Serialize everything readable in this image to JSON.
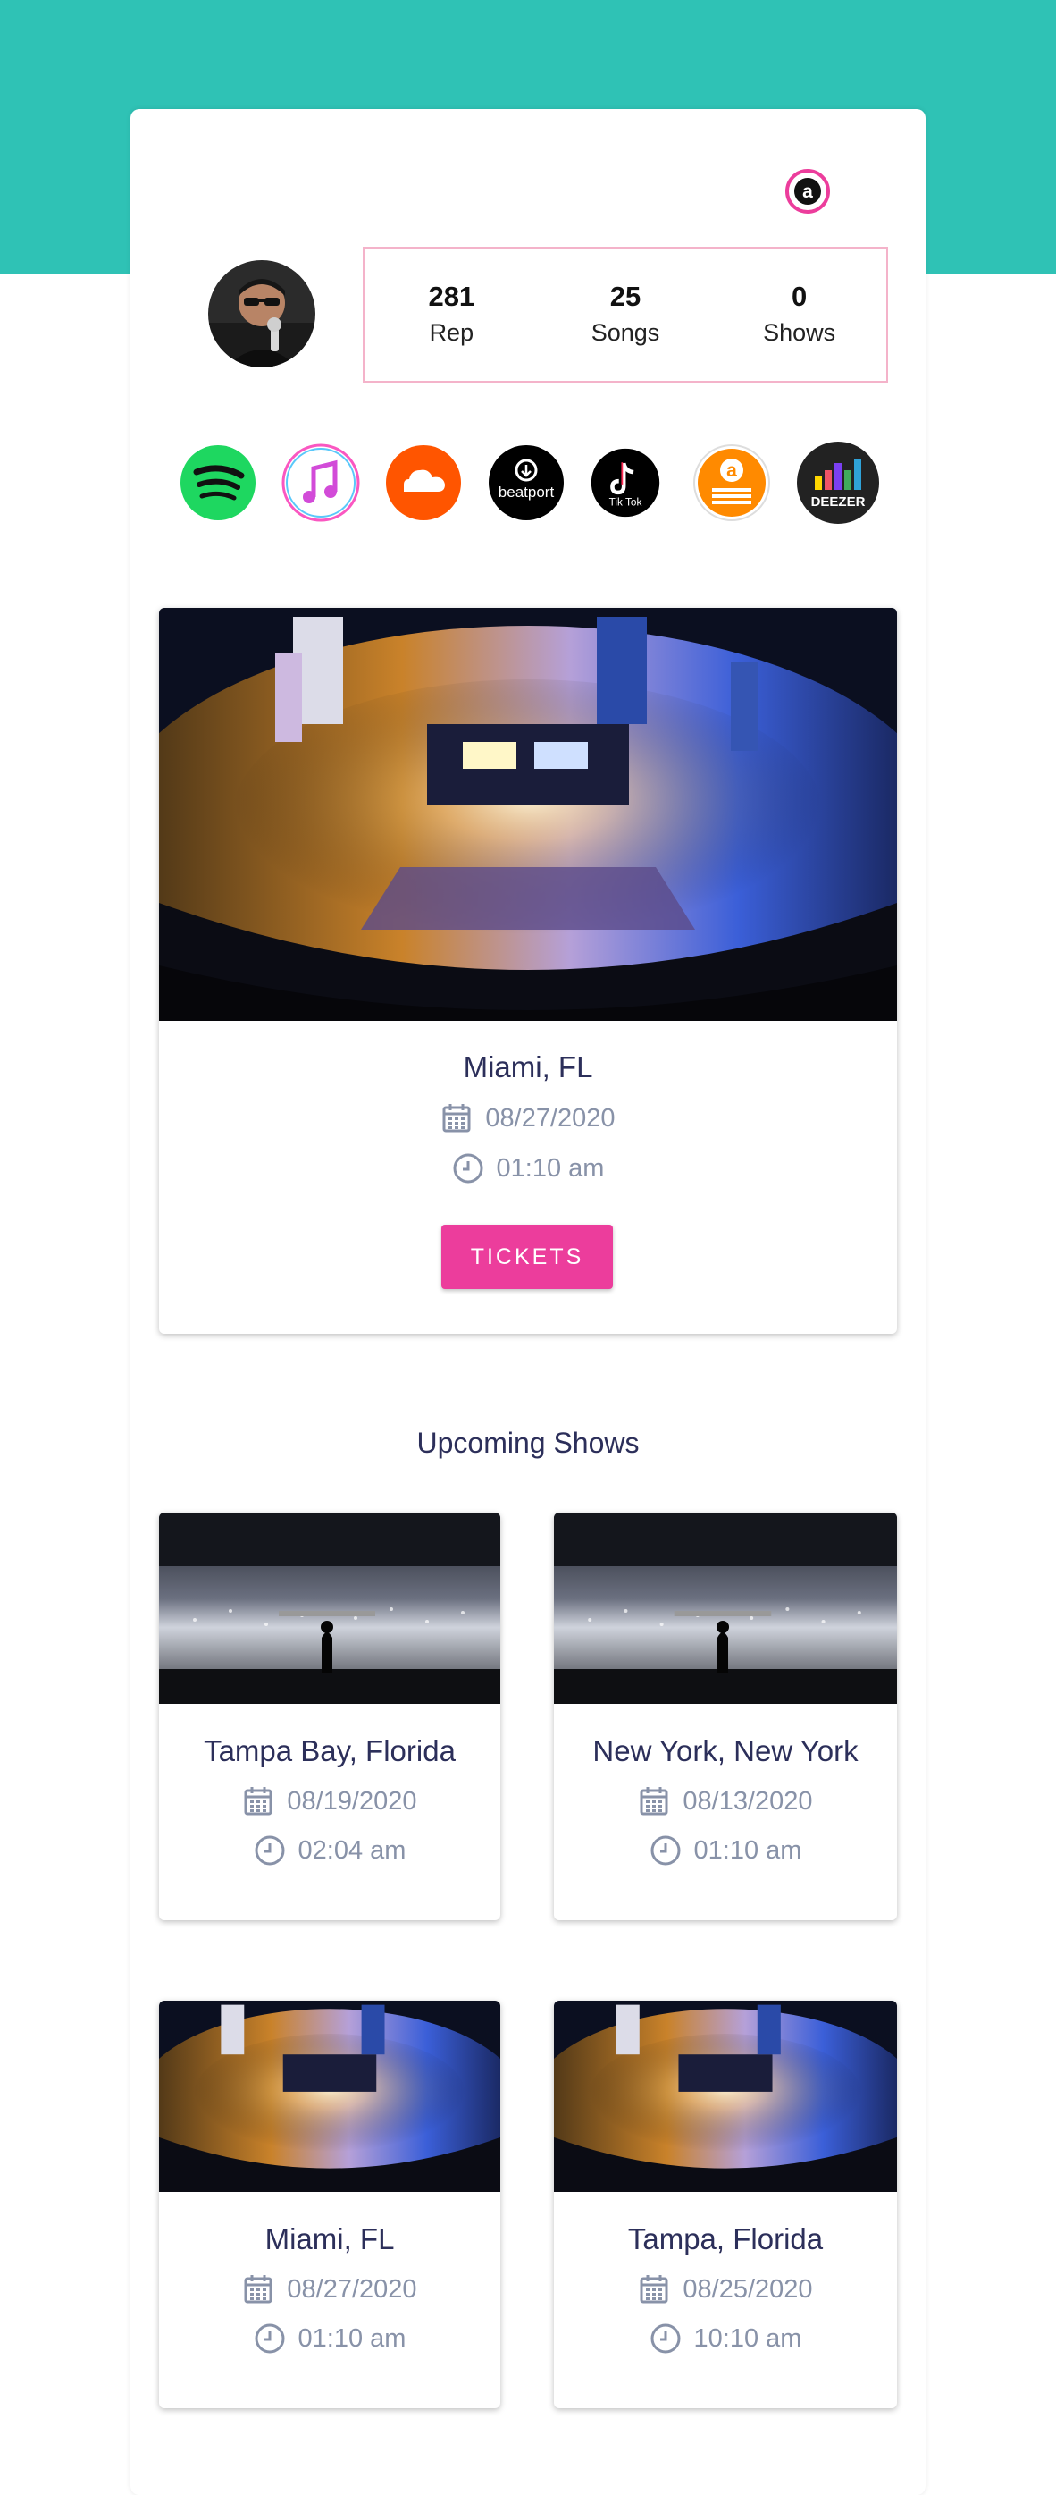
{
  "profile": {
    "avatar_icon": "artist-avatar",
    "brand_icon": "amuse-logo-icon"
  },
  "stats": [
    {
      "value": "281",
      "label": "Rep"
    },
    {
      "value": "25",
      "label": "Songs"
    },
    {
      "value": "0",
      "label": "Shows"
    }
  ],
  "platforms": [
    {
      "name": "spotify-icon",
      "color": "#1ed760"
    },
    {
      "name": "apple-music-icon",
      "color": "#fa57c1"
    },
    {
      "name": "soundcloud-icon",
      "color": "#ff5500"
    },
    {
      "name": "beatport-icon",
      "color": "#000000",
      "text": "beatport"
    },
    {
      "name": "tiktok-icon",
      "color": "#000000",
      "text": "Tik Tok"
    },
    {
      "name": "amazon-music-icon",
      "color": "#ff8a00",
      "text": "a"
    },
    {
      "name": "deezer-icon",
      "color": "#222222",
      "text": "DEEZER"
    }
  ],
  "featured": {
    "city": "Miami, FL",
    "date": "08/27/2020",
    "time": "01:10 am",
    "button": "TICKETS",
    "image": "arena-concert-image"
  },
  "upcoming": {
    "title": "Upcoming Shows",
    "shows": [
      {
        "city": "Tampa Bay, Florida",
        "date": "08/19/2020",
        "time": "02:04 am",
        "image": "stage-crowd-image"
      },
      {
        "city": "New York, New York",
        "date": "08/13/2020",
        "time": "01:10 am",
        "image": "stage-crowd-image"
      },
      {
        "city": "Miami, FL",
        "date": "08/27/2020",
        "time": "01:10 am",
        "image": "arena-concert-image"
      },
      {
        "city": "Tampa, Florida",
        "date": "08/25/2020",
        "time": "10:10 am",
        "image": "arena-concert-image"
      }
    ]
  },
  "colors": {
    "banner": "#2fc2b5",
    "accent": "#ec3d9c",
    "title_text": "#2c2f5a",
    "meta_text": "#8892a8"
  }
}
